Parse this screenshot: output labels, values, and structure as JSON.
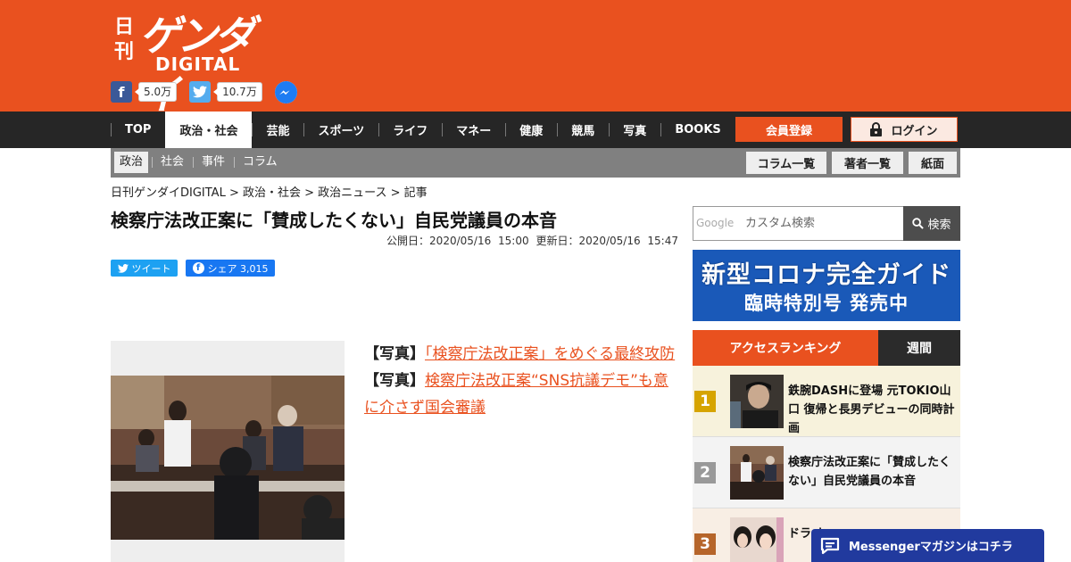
{
  "header": {
    "logo": {
      "nikkan": "日刊",
      "main": "ゲンダイ",
      "digital": "DIGITAL"
    },
    "social": {
      "facebook_count": "5.0万",
      "twitter_count": "10.7万"
    },
    "colors": {
      "brand": "#e9511f",
      "nav": "#262626",
      "facebook": "#3b5998",
      "twitter": "#55acee"
    }
  },
  "nav": {
    "items": [
      "TOP",
      "政治・社会",
      "芸能",
      "スポーツ",
      "ライフ",
      "マネー",
      "健康",
      "競馬",
      "写真",
      "BOOKS"
    ],
    "active_index": 1,
    "register_label": "会員登録",
    "login_label": "ログイン"
  },
  "subnav": {
    "items": [
      "政治",
      "社会",
      "事件",
      "コラム"
    ],
    "active_index": 0,
    "buttons": [
      "コラム一覧",
      "著者一覧",
      "紙面"
    ]
  },
  "breadcrumb": "日刊ゲンダイDIGITAL > 政治・社会 > 政治ニュース > 記事",
  "article": {
    "title": "検察庁法改正案に「賛成したくない」自民党議員の本音",
    "published": "公開日：2020/05/16 15:00",
    "updated": "更新日：2020/05/16 15:47",
    "tweet_label": "ツイート",
    "share_label": "シェア 3,015",
    "related": [
      {
        "label": "【写真】",
        "link": "「検察庁法改正案」をめぐる最終攻防"
      },
      {
        "label": "【写真】",
        "link": "検察庁法改正案“SNS抗議デモ”も意に介さず国会審議"
      }
    ]
  },
  "sidebar": {
    "search": {
      "google": "Google",
      "placeholder": "カスタム検索",
      "button": "検索"
    },
    "banner": {
      "line1": "新型コロナ完全ガイド",
      "line2": "臨時特別号 発売中"
    },
    "ranking": {
      "title": "アクセスランキング",
      "period": "週間",
      "items": [
        {
          "rank": "1",
          "text": "鉄腕DASHに登場 元TOKIO山口 復帰と長男デビューの同時計画",
          "color": "#d6a400",
          "bg": "#f7f2dc"
        },
        {
          "rank": "2",
          "text": "検察庁法改正案に「賛成したくない」自民党議員の本音",
          "color": "#999999",
          "bg": "#f3f3f3"
        },
        {
          "rank": "3",
          "text": "ドラ キー",
          "color": "#b6652a",
          "bg": "#f8eee4"
        }
      ]
    }
  },
  "messenger": {
    "label": "Messengerマガジンはコチラ"
  }
}
